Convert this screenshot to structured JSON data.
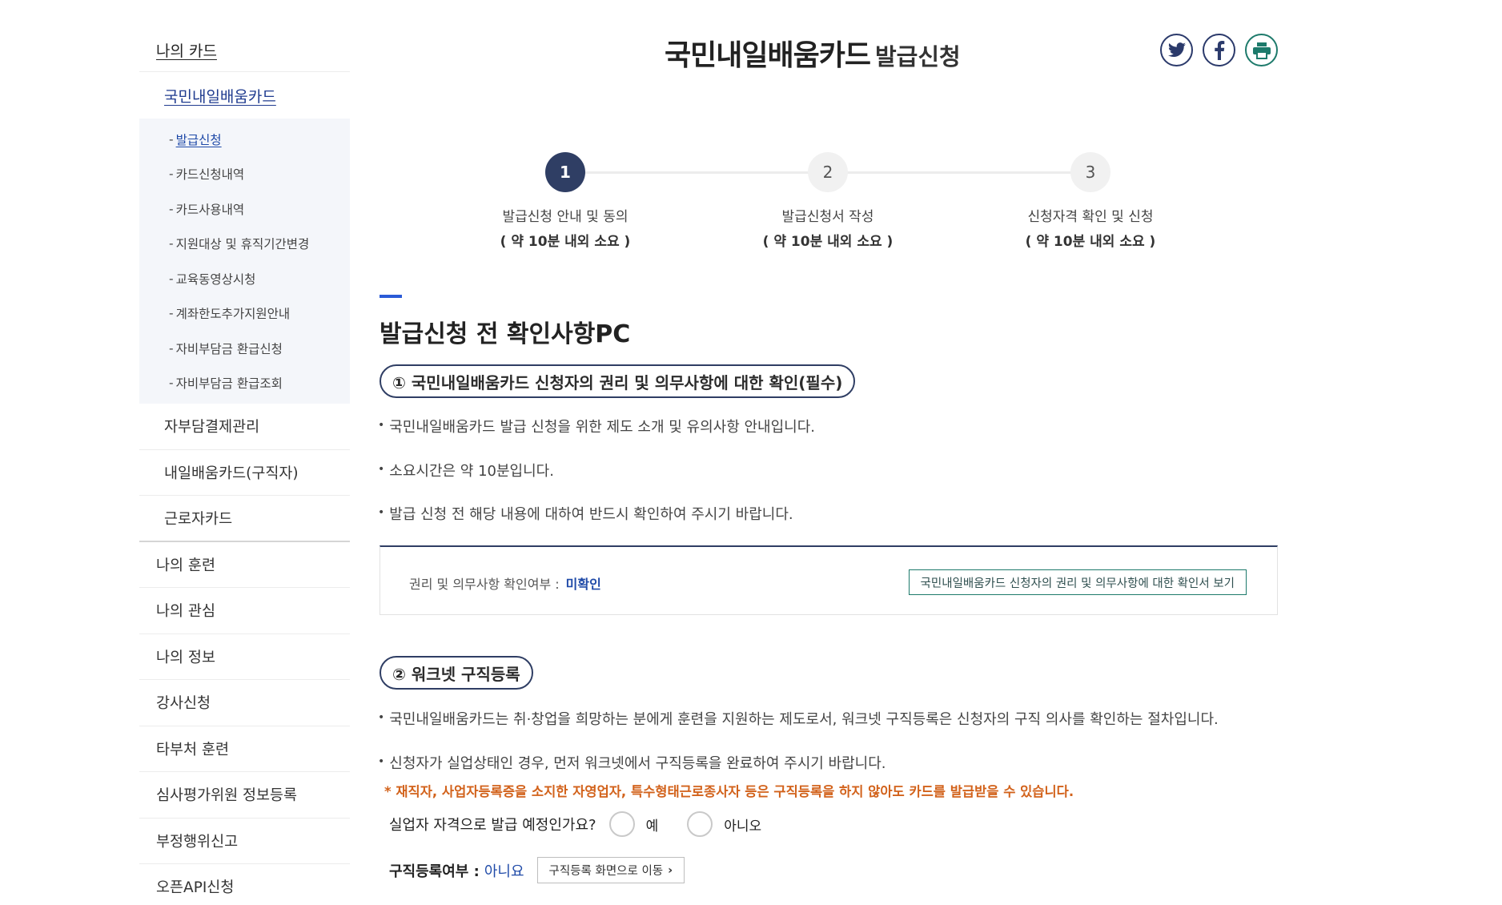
{
  "sidebar": {
    "title": "나의 카드",
    "sub_title": "국민내일배움카드",
    "children": [
      {
        "label": "발급신청"
      },
      {
        "label": "카드신청내역"
      },
      {
        "label": "카드사용내역"
      },
      {
        "label": "지원대상 및 휴직기간변경"
      },
      {
        "label": "교육동영상시청"
      },
      {
        "label": "계좌한도추가지원안내"
      },
      {
        "label": "자비부담금 환급신청"
      },
      {
        "label": "자비부담금 환급조회"
      }
    ],
    "sub_items": [
      "자부담결제관리",
      "내일배움카드(구직자)",
      "근로자카드"
    ],
    "items": [
      "나의 훈련",
      "나의 관심",
      "나의 정보",
      "강사신청",
      "타부처 훈련",
      "심사평가위원 정보등록",
      "부정행위신고",
      "오픈API신청"
    ]
  },
  "header": {
    "title": "국민내일배움카드",
    "subtitle": "발급신청",
    "share_icons": [
      "twitter-icon",
      "facebook-icon",
      "print-icon"
    ]
  },
  "stepper": {
    "steps": [
      {
        "num": "1",
        "label": "발급신청 안내 및 동의",
        "duration": "( 약 10분 내외 소요 )",
        "active": true
      },
      {
        "num": "2",
        "label": "발급신청서 작성",
        "duration": "( 약 10분 내외 소요 )",
        "active": false
      },
      {
        "num": "3",
        "label": "신청자격 확인 및 신청",
        "duration": "( 약 10분 내외 소요 )",
        "active": false
      }
    ]
  },
  "content": {
    "section_title": "발급신청 전 확인사항PC",
    "part1": {
      "pill": "① 국민내일배움카드 신청자의 권리 및 의무사항에 대한 확인(필수)",
      "bullets": [
        "국민내일배움카드 발급 신청을 위한 제도 소개 및 유의사항 안내입니다.",
        "소요시간은 약 10분입니다.",
        "발급 신청 전 해당 내용에 대하여 반드시 확인하여 주시기 바랍니다."
      ],
      "confirm_label": "권리 및 의무사항 확인여부 :",
      "confirm_value": "미확인",
      "confirm_button": "국민내일배움카드 신청자의 권리 및 의무사항에 대한 확인서 보기"
    },
    "part2": {
      "pill": "② 워크넷 구직등록",
      "bullets": [
        "국민내일배움카드는 취·창업을 희망하는 분에게 훈련을 지원하는 제도로서, 워크넷 구직등록은 신청자의 구직 의사를 확인하는 절차입니다.",
        "신청자가 실업상태인 경우, 먼저 워크넷에서 구직등록을 완료하여 주시기 바랍니다."
      ],
      "notice": "* 재직자, 사업자등록증을 소지한 자영업자, 특수형태근로종사자 등은 구직등록을 하지 않아도 카드를 발급받을 수 있습니다.",
      "question": "실업자 자격으로 발급 예정인가요?",
      "option_yes": "예",
      "option_no": "아니오",
      "status_label": "구직등록여부 :",
      "status_value": "아니요",
      "move_button": "구직등록 화면으로 이동"
    }
  },
  "colors": {
    "primary": "#2f3e64",
    "link": "#1f4aa8",
    "notice": "#d2621b",
    "accent": "#2a5bd7"
  }
}
